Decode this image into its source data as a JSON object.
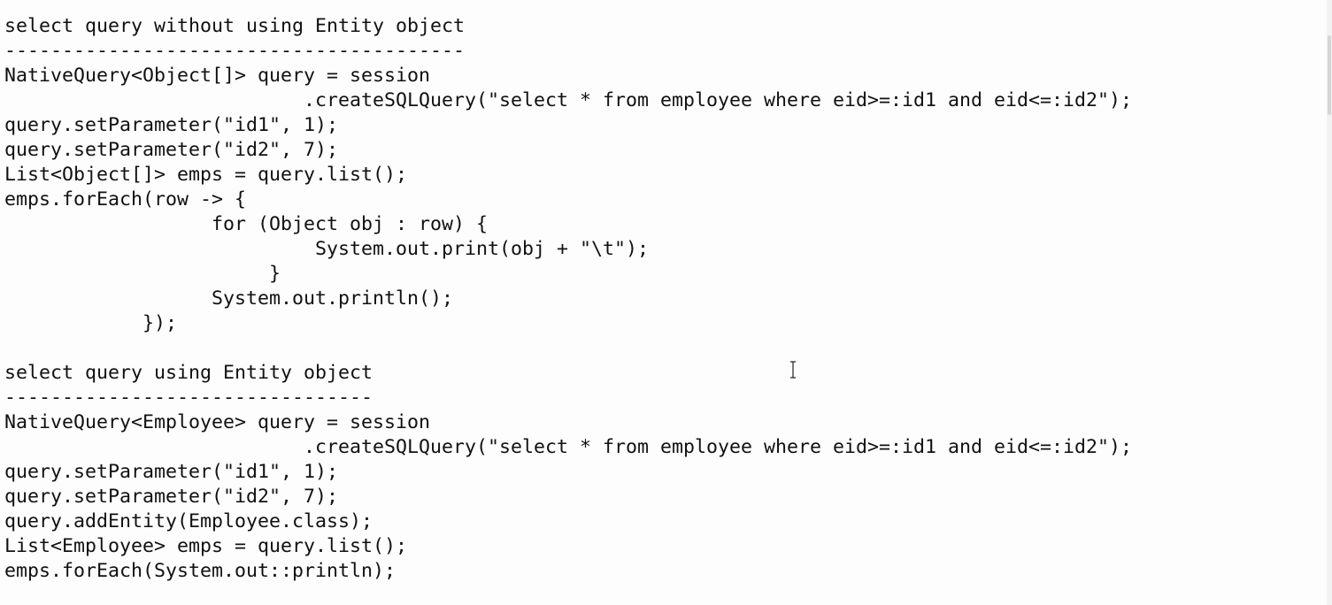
{
  "editor": {
    "lines": [
      "select query without using Entity object",
      "----------------------------------------",
      "NativeQuery<Object[]> query = session",
      "                          .createSQLQuery(\"select * from employee where eid>=:id1 and eid<=:id2\");",
      "query.setParameter(\"id1\", 1);",
      "query.setParameter(\"id2\", 7);",
      "List<Object[]> emps = query.list();",
      "emps.forEach(row -> {",
      "                  for (Object obj : row) {",
      "                           System.out.print(obj + \"\\t\");",
      "                       }",
      "                  System.out.println();",
      "            });",
      "",
      "select query using Entity object",
      "--------------------------------",
      "NativeQuery<Employee> query = session",
      "                          .createSQLQuery(\"select * from employee where eid>=:id1 and eid<=:id2\");",
      "query.setParameter(\"id1\", 1);",
      "query.setParameter(\"id2\", 7);",
      "query.addEntity(Employee.class);",
      "List<Employee> emps = query.list();",
      "emps.forEach(System.out::println);"
    ]
  },
  "cursor": {
    "icon": "text-cursor-icon"
  }
}
